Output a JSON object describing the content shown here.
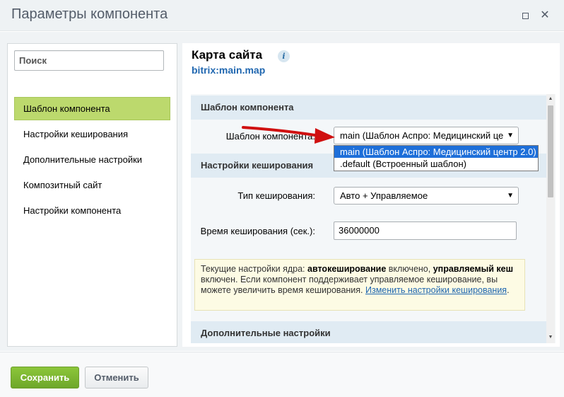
{
  "window": {
    "title": "Параметры компонента",
    "maximize_icon": "maximize-icon",
    "close_icon": "close-icon",
    "close_glyph": "✕"
  },
  "sidebar": {
    "search_placeholder": "Поиск",
    "items": [
      {
        "label": "Шаблон компонента",
        "active": true
      },
      {
        "label": "Настройки кеширования",
        "active": false
      },
      {
        "label": "Дополнительные настройки",
        "active": false
      },
      {
        "label": "Композитный сайт",
        "active": false
      },
      {
        "label": "Настройки компонента",
        "active": false
      }
    ]
  },
  "component": {
    "title": "Карта сайта",
    "info_icon_glyph": "i",
    "code": "bitrix:main.map"
  },
  "sections": {
    "template": {
      "header": "Шаблон компонента",
      "field_label": "Шаблон компонента:",
      "selected_value": "main (Шаблон Аспро: Медицинский це",
      "options": [
        {
          "label": "main (Шаблон Аспро: Медицинский центр 2.0)",
          "selected": true
        },
        {
          "label": ".default (Встроенный шаблон)",
          "selected": false
        }
      ]
    },
    "cache": {
      "header": "Настройки кеширования",
      "type_label": "Тип кеширования:",
      "type_value": "Авто + Управляемое",
      "time_label": "Время кеширования (сек.):",
      "time_value": "36000000"
    },
    "note": {
      "text_1": "Текущие настройки ядра: ",
      "bold_1": "автокеширование",
      "text_2": " включено, ",
      "bold_2": "управляемый кеш",
      "text_3": " включен. Если компонент поддерживает управляемое кеширование, вы можете увеличить время кеширования. ",
      "link": "Изменить настройки кеширования",
      "text_4": "."
    },
    "additional": {
      "header": "Дополнительные настройки"
    }
  },
  "footer": {
    "save_label": "Сохранить",
    "cancel_label": "Отменить"
  },
  "colors": {
    "accent_green": "#8cc63a",
    "active_nav": "#bcd96d",
    "link_blue": "#2067b0",
    "annotation_arrow": "#d01010",
    "dropdown_highlight": "#1e6fd9"
  }
}
